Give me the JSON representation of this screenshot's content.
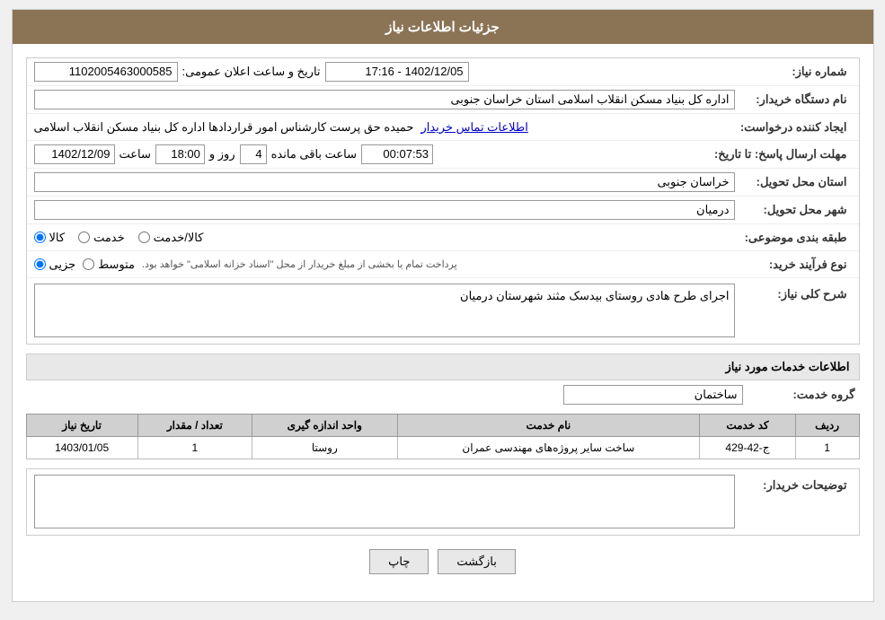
{
  "header": {
    "title": "جزئیات اطلاعات نیاز"
  },
  "fields": {
    "need_number_label": "شماره نیاز:",
    "need_number_value": "1102005463000585",
    "announce_date_label": "تاریخ و ساعت اعلان عمومی:",
    "announce_date_value": "1402/12/05 - 17:16",
    "buyer_org_label": "نام دستگاه خریدار:",
    "buyer_org_value": "اداره کل بنیاد مسکن انقلاب اسلامی استان خراسان جنوبی",
    "creator_label": "ایجاد کننده درخواست:",
    "creator_value": "حمیده حق پرست کارشناس امور قراردادها اداره کل بنیاد مسکن انقلاب اسلامی",
    "creator_link": "اطلاعات تماس خریدار",
    "deadline_label": "مهلت ارسال پاسخ: تا تاریخ:",
    "deadline_date": "1402/12/09",
    "deadline_time_label": "ساعت",
    "deadline_time": "18:00",
    "deadline_days_label": "روز و",
    "deadline_days": "4",
    "deadline_remaining_label": "ساعت باقی مانده",
    "deadline_remaining": "00:07:53",
    "province_label": "استان محل تحویل:",
    "province_value": "خراسان جنوبی",
    "city_label": "شهر محل تحویل:",
    "city_value": "درمیان",
    "category_label": "طبقه بندی موضوعی:",
    "category_kala": "کالا",
    "category_khedmat": "خدمت",
    "category_kala_khedmat": "کالا/خدمت",
    "purchase_type_label": "نوع فرآیند خرید:",
    "purchase_jozei": "جزیی",
    "purchase_motavasset": "متوسط",
    "purchase_note": "پرداخت تمام یا بخشی از مبلغ خریدار از محل \"اسناد خزانه اسلامی\" خواهد بود.",
    "description_label": "شرح کلی نیاز:",
    "description_value": "اجرای طرح هادی روستای بیدسک مثند شهرستان درمیان",
    "services_title": "اطلاعات خدمات مورد نیاز",
    "service_group_label": "گروه خدمت:",
    "service_group_value": "ساختمان",
    "table": {
      "headers": [
        "ردیف",
        "کد خدمت",
        "نام خدمت",
        "واحد اندازه گیری",
        "تعداد / مقدار",
        "تاریخ نیاز"
      ],
      "rows": [
        {
          "row": "1",
          "code": "ج-42-429",
          "name": "ساخت سایر پروژه‌های مهندسی عمران",
          "unit": "روستا",
          "quantity": "1",
          "date": "1403/01/05"
        }
      ]
    },
    "buyer_notes_label": "توضیحات خریدار:",
    "buyer_notes_value": ""
  },
  "buttons": {
    "print": "چاپ",
    "back": "بازگشت"
  }
}
